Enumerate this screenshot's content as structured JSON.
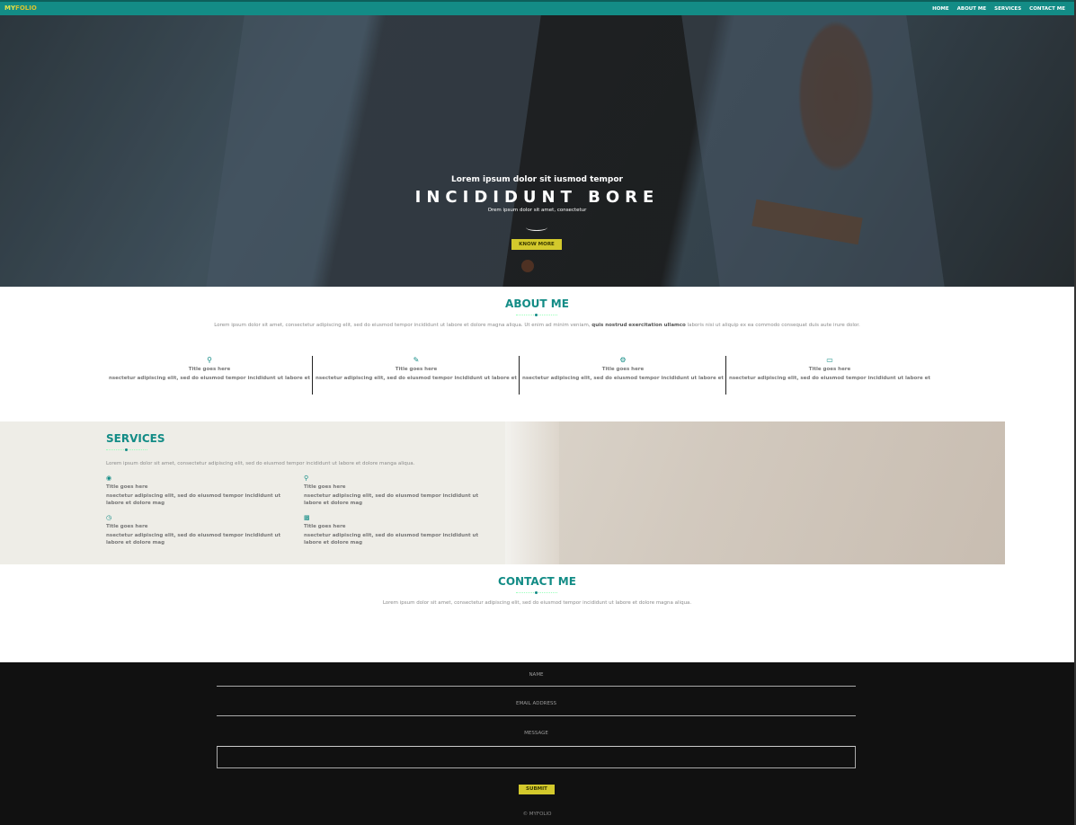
{
  "navbar": {
    "brand_part1": "MY",
    "brand_part2": "FOLIO",
    "items": [
      "HOME",
      "ABOUT ME",
      "SERVICES",
      "CONTACT ME"
    ],
    "color": "#138c86"
  },
  "hero": {
    "subtitle": "Lorem ipsum dolor sit iusmod tempor",
    "title": "INCIDIDUNT BORE",
    "small_text": "Orem ipsum dolor sit amet, consectetur",
    "button_label": "KNOW MORE"
  },
  "about": {
    "title": "ABOUT ME",
    "description_start": "Lorem ipsum dolor sit amet, consectetur adipiscing elit, sed do eiusmod tempor incididunt ut labore et dolore magna aliqua. Ut enim ad minim veniam, ",
    "description_bold": "quis nostrud exercitation ullamco",
    "description_end": " laboris nisi ut aliquip ex ea commodo consequat duis aute irure dolor.",
    "features": [
      {
        "icon": "lightbulb-icon",
        "title": "Title goes here",
        "text": "nsectetur adipiscing elit, sed do eiusmod tempor incididunt ut labore et"
      },
      {
        "icon": "pencil-icon",
        "title": "Title goes here",
        "text": "nsectetur adipiscing elit, sed do eiusmod tempor incididunt ut labore et"
      },
      {
        "icon": "gear-icon",
        "title": "Title goes here",
        "text": "nsectetur adipiscing elit, sed do eiusmod tempor incididunt ut labore et"
      },
      {
        "icon": "laptop-icon",
        "title": "Title goes here",
        "text": "nsectetur adipiscing elit, sed do eiusmod tempor incididunt ut labore et"
      }
    ]
  },
  "services": {
    "title": "SERVICES",
    "description": "Lorem ipsum dolor sit amet, consectetur adipiscing elit, sed do eiusmod tempor incididunt ut labore et dolore manga aliqua.",
    "items": [
      {
        "icon": "globe-icon",
        "title": "Title goes here",
        "text": "nsectetur adipiscing elit, sed do eiusmod tempor incididunt ut labore et dolore mag"
      },
      {
        "icon": "search-icon",
        "title": "Title goes here",
        "text": "nsectetur adipiscing elit, sed do eiusmod tempor incididunt ut labore et dolore mag"
      },
      {
        "icon": "clock-icon",
        "title": "Title goes here",
        "text": "nsectetur adipiscing elit, sed do eiusmod tempor incididunt ut labore et dolore mag"
      },
      {
        "icon": "bar-chart-icon",
        "title": "Title goes here",
        "text": "nsectetur adipiscing elit, sed do eiusmod tempor incididunt ut labore et dolore mag"
      }
    ]
  },
  "contact": {
    "title": "CONTACT ME",
    "description": "Lorem ipsum dolor sit amet, consectetur adipiscing elit, sed do eiusmod tempor incididunt ut labore et dolore magna aliqua.",
    "name_placeholder": "NAME",
    "email_placeholder": "EMAIL ADDRESS",
    "message_placeholder": "MESSAGE",
    "submit_label": "SUBMIT"
  },
  "footer": {
    "copyright": "© MYFOLIO"
  },
  "colors": {
    "accent": "#138c86",
    "button": "#d3c92c",
    "footer_bg": "#111111"
  }
}
